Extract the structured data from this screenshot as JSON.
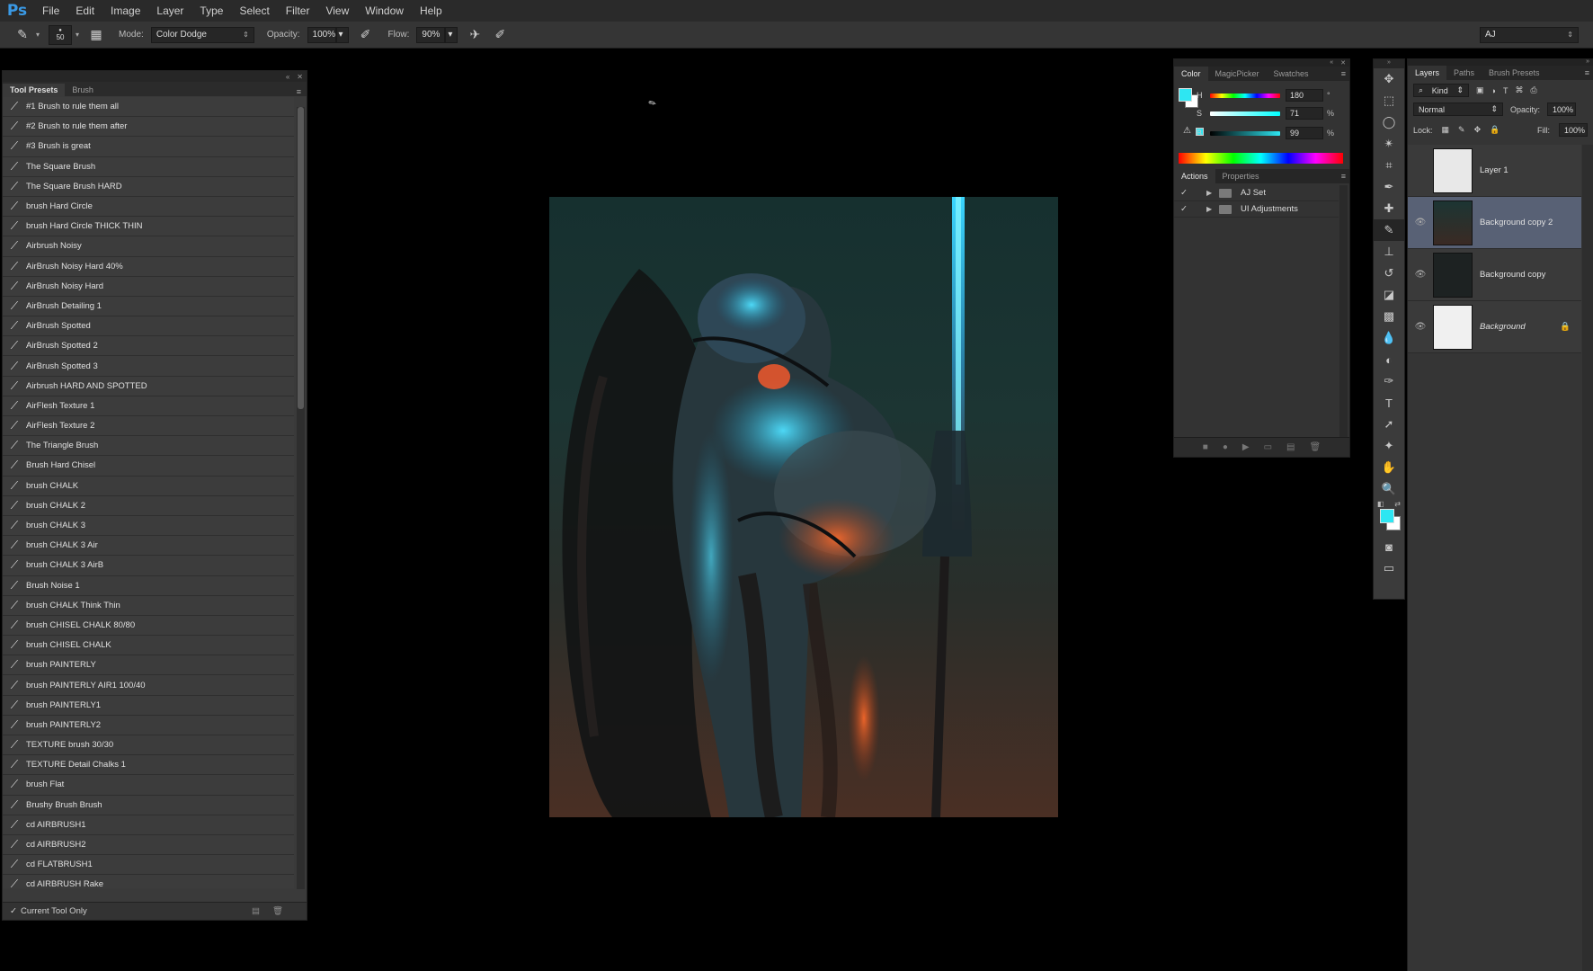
{
  "app": {
    "logo": "Ps"
  },
  "menu": [
    "File",
    "Edit",
    "Image",
    "Layer",
    "Type",
    "Select",
    "Filter",
    "View",
    "Window",
    "Help"
  ],
  "options": {
    "brush_size": "50",
    "mode_label": "Mode:",
    "mode_value": "Color Dodge",
    "opacity_label": "Opacity:",
    "opacity_value": "100%",
    "flow_label": "Flow:",
    "flow_value": "90%",
    "workspace": "AJ"
  },
  "tool_presets": {
    "tabs": [
      "Tool Presets",
      "Brush"
    ],
    "items": [
      "#1 Brush to rule them all",
      "#2 Brush to rule them after",
      "#3 Brush is great",
      "The Square Brush",
      "The Square Brush HARD",
      "brush Hard Circle",
      "brush Hard Circle THICK THIN",
      "Airbrush Noisy",
      "AirBrush Noisy Hard 40%",
      "AirBrush Noisy Hard",
      "AirBrush Detailing 1",
      "AirBrush Spotted",
      "AirBrush Spotted 2",
      "AirBrush Spotted 3",
      "Airbrush HARD AND SPOTTED",
      "AirFlesh Texture 1",
      "AirFlesh Texture 2",
      "The Triangle Brush",
      "Brush Hard Chisel",
      "brush CHALK",
      "brush CHALK 2",
      "brush CHALK 3",
      "brush CHALK 3 Air",
      "brush CHALK 3 AirB",
      "Brush Noise 1",
      "brush CHALK Think Thin",
      "brush CHISEL CHALK 80/80",
      "brush CHISEL CHALK",
      "brush PAINTERLY",
      "brush PAINTERLY AIR1 100/40",
      "brush PAINTERLY1",
      "brush PAINTERLY2",
      "TEXTURE brush 30/30",
      "TEXTURE Detail Chalks 1",
      "brush Flat",
      "Brushy Brush Brush",
      "cd AIRBRUSH1",
      "cd AIRBRUSH2",
      "cd FLATBRUSH1",
      "cd AIRBRUSH Rake"
    ],
    "footer": "Current Tool Only"
  },
  "color_panel": {
    "tabs": [
      "Color",
      "MagicPicker",
      "Swatches"
    ],
    "h_label": "H",
    "h_value": "180",
    "h_unit": "°",
    "s_label": "S",
    "s_value": "71",
    "s_unit": "%",
    "b_label": "B",
    "b_value": "99",
    "b_unit": "%",
    "foreground": "#2ee6f2",
    "background": "#ffffff"
  },
  "actions_panel": {
    "tabs": [
      "Actions",
      "Properties"
    ],
    "items": [
      "AJ Set",
      "UI Adjustments"
    ]
  },
  "layers_panel": {
    "tabs": [
      "Layers",
      "Paths",
      "Brush Presets"
    ],
    "kind_label": "Kind",
    "blend_mode": "Normal",
    "opacity_label": "Opacity:",
    "opacity_value": "100%",
    "lock_label": "Lock:",
    "fill_label": "Fill:",
    "fill_value": "100%",
    "layers": [
      {
        "name": "Layer 1",
        "visible": false,
        "selected": false
      },
      {
        "name": "Background copy 2",
        "visible": true,
        "selected": true
      },
      {
        "name": "Background copy",
        "visible": true,
        "selected": false
      },
      {
        "name": "Background",
        "visible": true,
        "selected": false,
        "locked": true
      }
    ]
  },
  "colors": {
    "accent": "#2ee6f2",
    "selection": "#586175"
  }
}
